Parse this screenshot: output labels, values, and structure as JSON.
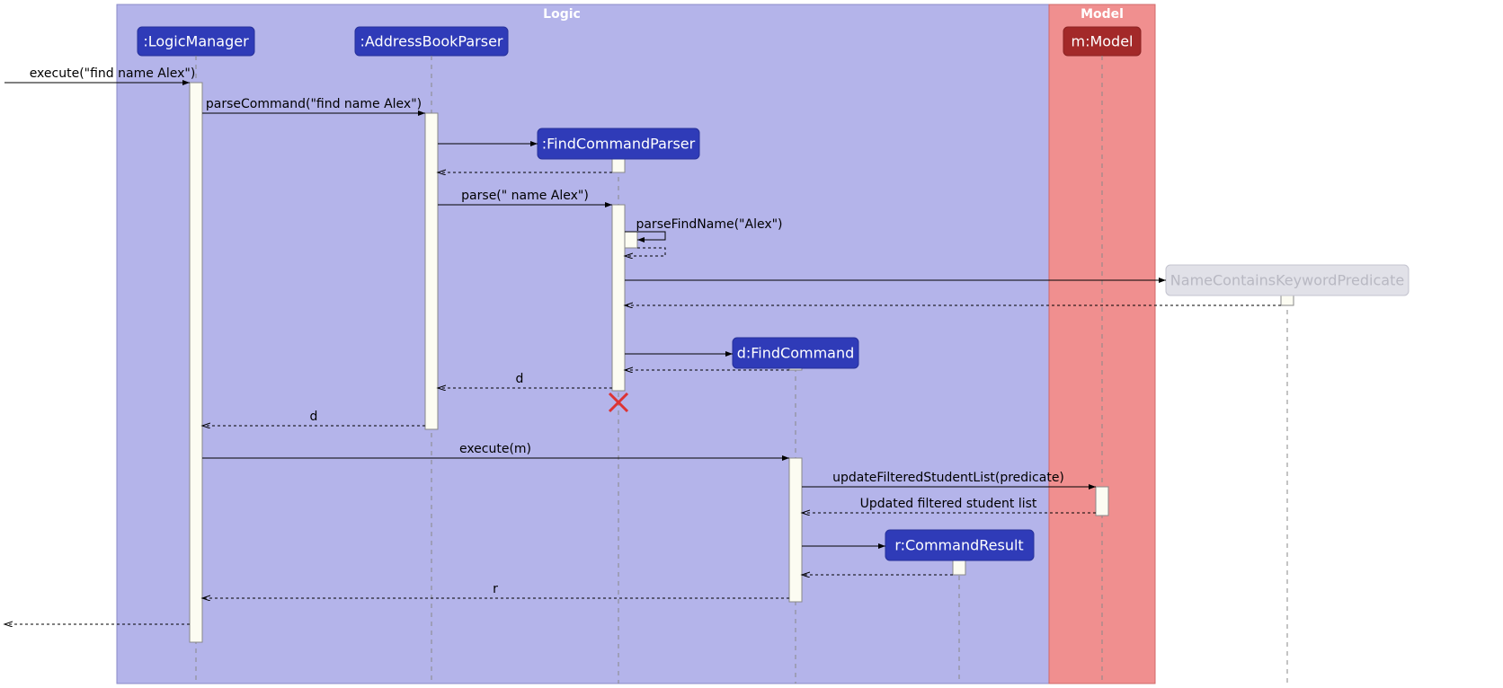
{
  "frames": {
    "logic": {
      "label": "Logic"
    },
    "model": {
      "label": "Model"
    }
  },
  "participants": {
    "logicManager": {
      "label": ":LogicManager"
    },
    "parser": {
      "label": ":AddressBookParser"
    },
    "findParser": {
      "label": ":FindCommandParser"
    },
    "findCmd": {
      "label": "d:FindCommand"
    },
    "cmdResult": {
      "label": "r:CommandResult"
    },
    "model": {
      "label": "m:Model"
    },
    "predicate": {
      "label": "NameContainsKeywordPredicate"
    }
  },
  "messages": {
    "m1": "execute(\"find name Alex\")",
    "m2": "parseCommand(\"find name Alex\")",
    "m3": "parse(\" name Alex\")",
    "m4": "parseFindName(\"Alex\")",
    "m5": "d",
    "m6": "d",
    "m7": "execute(m)",
    "m8": "updateFilteredStudentList(predicate)",
    "m9": "Updated filtered student list",
    "m10": "r"
  }
}
